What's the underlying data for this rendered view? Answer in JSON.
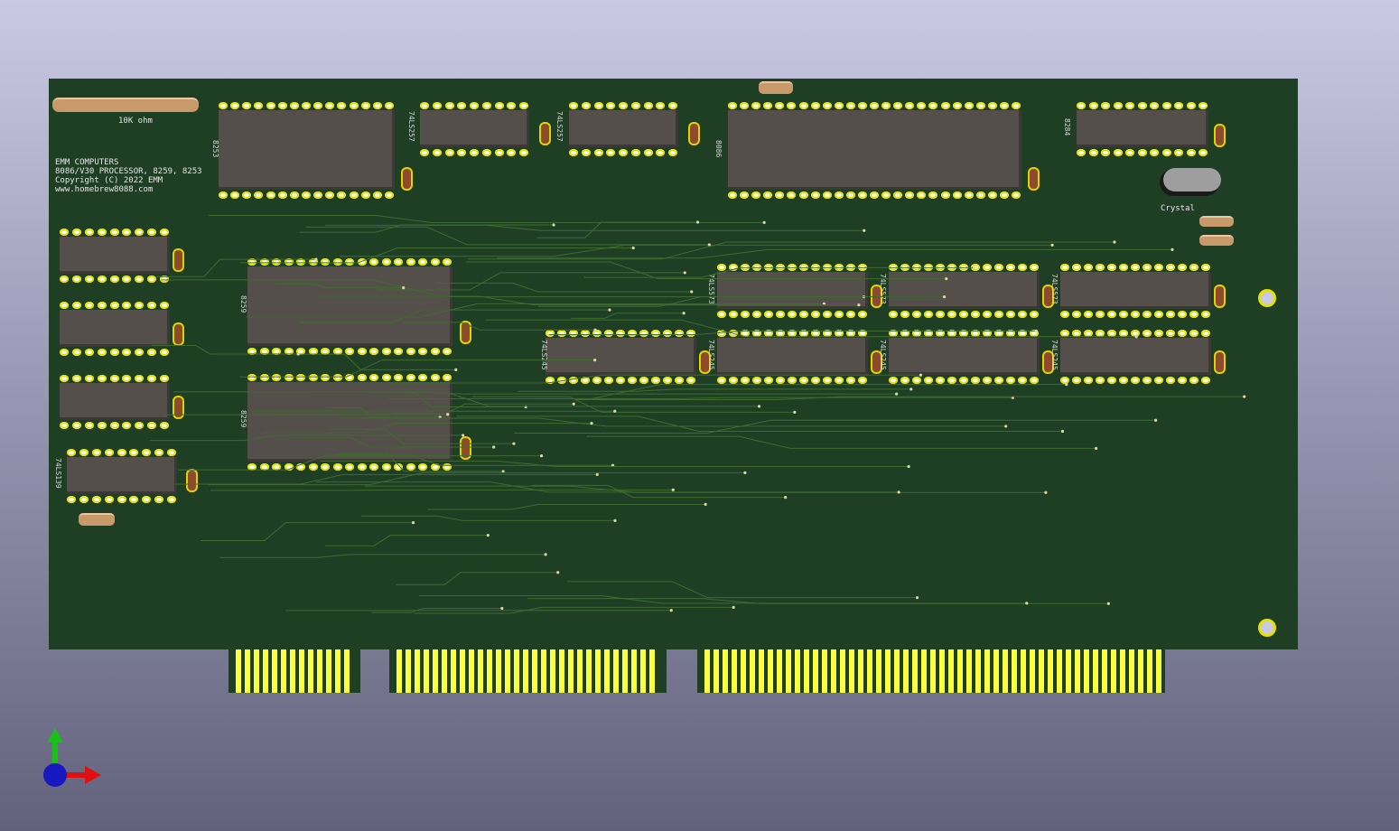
{
  "board": {
    "silkscreen": {
      "company": "EMM COMPUTERS",
      "product": "8086/V30 PROCESSOR, 8259, 8253",
      "copyright": "Copyright (C) 2022 EMM",
      "website": "www.homebrew8088.com",
      "resistor_label": "10K ohm",
      "crystal_label": "Crystal"
    },
    "chips": [
      {
        "label": "8253"
      },
      {
        "label": "74LS257"
      },
      {
        "label": "74LS257"
      },
      {
        "label": "8086"
      },
      {
        "label": "8284"
      },
      {
        "label": "8259"
      },
      {
        "label": "8259"
      },
      {
        "label": "74LS573"
      },
      {
        "label": "74LS573"
      },
      {
        "label": "74LS573"
      },
      {
        "label": "74LS245"
      },
      {
        "label": "74LS245"
      },
      {
        "label": "74LS245"
      },
      {
        "label": "74LS245"
      },
      {
        "label": "74LS139"
      }
    ]
  },
  "colors": {
    "pcb": "#1f3f25",
    "chip_body": "#554f4b",
    "gold_finger": "#fbff3d",
    "pad_ring": "#e6e200",
    "capacitor": "#8c4b2a",
    "silkscreen": "#e6e6e6"
  },
  "axes_gizmo": {
    "x_color": "#e01010",
    "y_color": "#18c018",
    "z_color": "#1818c0"
  }
}
